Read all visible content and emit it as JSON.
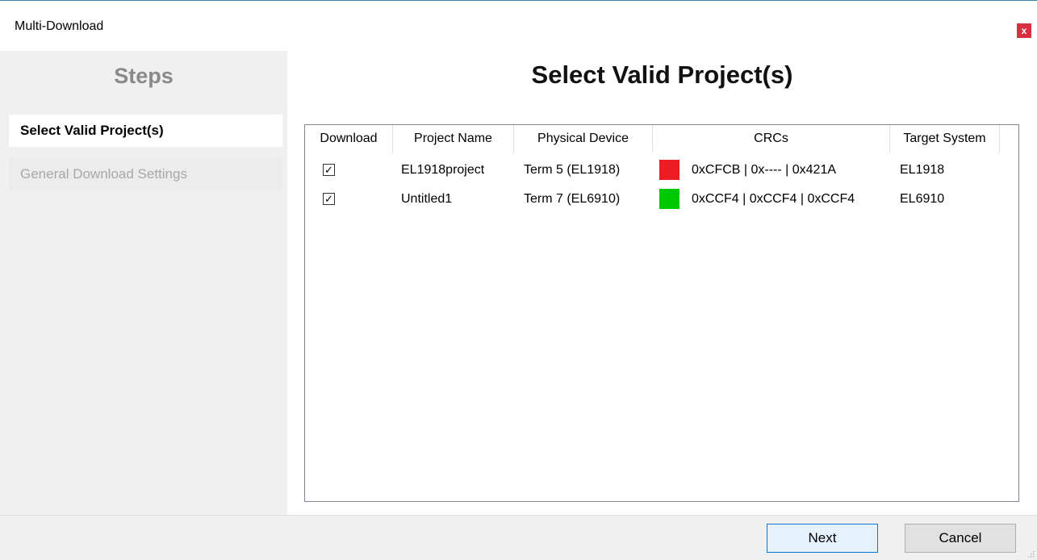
{
  "window": {
    "title": "Multi-Download",
    "close_glyph": "x"
  },
  "sidebar": {
    "title": "Steps",
    "steps": [
      {
        "label": "Select Valid Project(s)",
        "state": "active"
      },
      {
        "label": "General Download Settings",
        "state": "inactive"
      }
    ]
  },
  "main": {
    "title": "Select Valid Project(s)",
    "table": {
      "columns": [
        "Download",
        "Project Name",
        "Physical Device",
        "CRCs",
        "Target System"
      ],
      "rows": [
        {
          "download": true,
          "project_name": "EL1918project",
          "physical_device": "Term 5 (EL1918)",
          "crc_status_color": "#ed1c24",
          "crcs": "0xCFCB | 0x---- | 0x421A",
          "target_system": "EL1918"
        },
        {
          "download": true,
          "project_name": "Untitled1",
          "physical_device": "Term 7 (EL6910)",
          "crc_status_color": "#00c800",
          "crcs": "0xCCF4 | 0xCCF4 | 0xCCF4",
          "target_system": "EL6910"
        }
      ]
    }
  },
  "footer": {
    "next_label": "Next",
    "cancel_label": "Cancel"
  },
  "icons": {
    "checkbox_checked": "✓",
    "resize_grip": "resize-grip-icon"
  }
}
